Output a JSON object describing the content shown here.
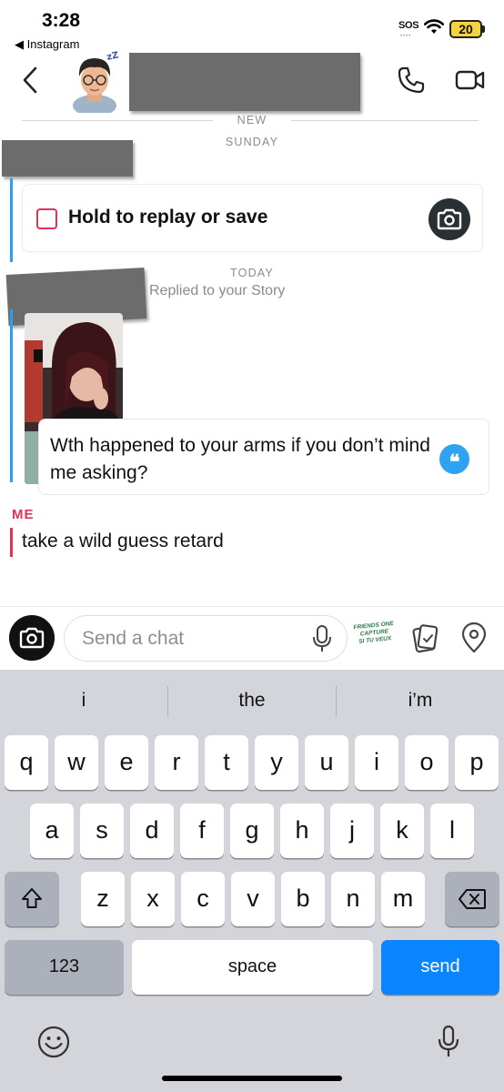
{
  "status_bar": {
    "time": "3:28",
    "back_app": "◀ Instagram",
    "sos": "SOS",
    "battery": "20"
  },
  "header": {
    "back_icon": "chevron-left-icon",
    "call_icon": "phone-icon",
    "video_icon": "video-camera-icon"
  },
  "chat": {
    "new_label": "NEW",
    "sunday_label": "SUNDAY",
    "snap_label": "Hold to replay or save",
    "today_label": "TODAY",
    "replied_label": "Replied to your Story",
    "reply_text": "Wth happened to your arms if you don’t mind me asking?",
    "me_label": "ME",
    "me_text": "take a wild guess retard",
    "colors": {
      "sent_accent": "#e03357",
      "received_accent": "#2f9cf2"
    }
  },
  "composer": {
    "placeholder": "Send a chat",
    "sticker_text": [
      "FRIENDS ONE",
      "CAPTURE",
      "SI TU VEUX"
    ]
  },
  "keyboard": {
    "suggestions": [
      "i",
      "the",
      "i’m"
    ],
    "row1": [
      "q",
      "w",
      "e",
      "r",
      "t",
      "y",
      "u",
      "i",
      "o",
      "p"
    ],
    "row2": [
      "a",
      "s",
      "d",
      "f",
      "g",
      "h",
      "j",
      "k",
      "l"
    ],
    "row3": [
      "z",
      "x",
      "c",
      "v",
      "b",
      "n",
      "m"
    ],
    "numbers_label": "123",
    "space_label": "space",
    "send_label": "send"
  }
}
